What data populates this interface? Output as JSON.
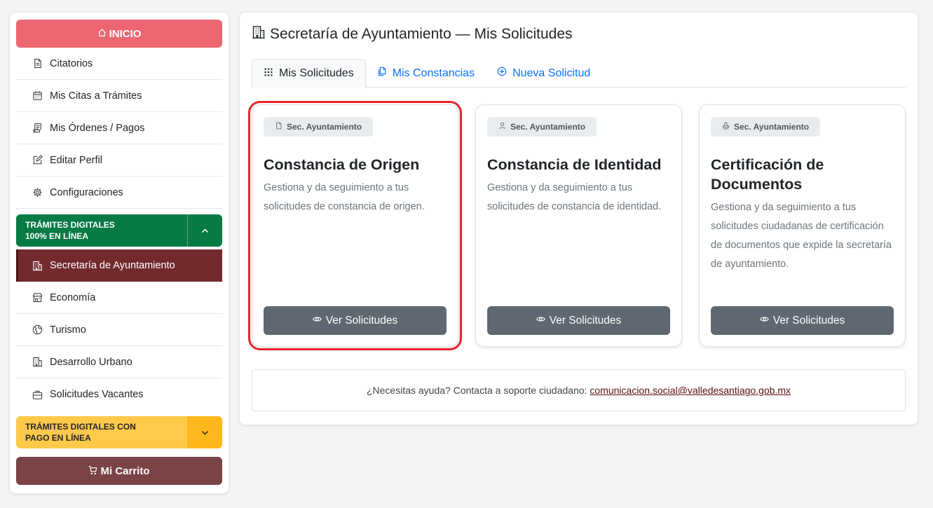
{
  "sidebar": {
    "inicio_label": "INICIO",
    "items": [
      {
        "label": "Citatorios",
        "icon": "file-icon"
      },
      {
        "label": "Mis Citas a Trámites",
        "icon": "calendar-icon"
      },
      {
        "label": "Mis Órdenes / Pagos",
        "icon": "receipt-icon"
      },
      {
        "label": "Editar Perfil",
        "icon": "edit-icon"
      },
      {
        "label": "Configuraciones",
        "icon": "gear-icon"
      }
    ],
    "group_online": {
      "line1": "TRÁMITES DIGITALES",
      "line2": "100% EN LÍNEA"
    },
    "online_items": [
      {
        "label": "Secretaría de Ayuntamiento",
        "icon": "building-icon",
        "active": true
      },
      {
        "label": "Economía",
        "icon": "shop-icon"
      },
      {
        "label": "Turismo",
        "icon": "globe-icon"
      },
      {
        "label": "Desarrollo Urbano",
        "icon": "building-icon"
      },
      {
        "label": "Solicitudes Vacantes",
        "icon": "briefcase-icon"
      }
    ],
    "group_paid": {
      "line1": "TRÁMITES DIGITALES CON",
      "line2": "PAGO EN LÍNEA"
    },
    "cart_label": "Mi Carrito"
  },
  "main": {
    "title": "Secretaría de Ayuntamiento — Mis Solicitudes",
    "tabs": [
      {
        "label": "Mis Solicitudes",
        "icon": "grid-icon",
        "active": true
      },
      {
        "label": "Mis Constancias",
        "icon": "copy-icon"
      },
      {
        "label": "Nueva Solicitud",
        "icon": "plus-circle-icon"
      }
    ],
    "cards": [
      {
        "badge": "Sec. Ayuntamiento",
        "badge_icon": "file-icon",
        "title": "Constancia de Origen",
        "description": "Gestiona y da seguimiento a tus solicitudes de constancia de origen.",
        "button": "Ver Solicitudes"
      },
      {
        "badge": "Sec. Ayuntamiento",
        "badge_icon": "person-icon",
        "title": "Constancia de Identidad",
        "description": "Gestiona y da seguimiento a tus solicitudes de constancia de identidad.",
        "button": "Ver Solicitudes"
      },
      {
        "badge": "Sec. Ayuntamiento",
        "badge_icon": "stamp-icon",
        "title": "Certificación de Documentos",
        "description": "Gestiona y da seguimiento a tus solicitudes ciudadanas de certificación de documentos que expide la secretaría de ayuntamiento.",
        "button": "Ver Solicitudes"
      }
    ],
    "help_text": "¿Necesitas ayuda? Contacta a soporte ciudadano:",
    "help_email": "comunicacion.social@valledesantiago.gob.mx"
  },
  "colors": {
    "inicio": "#ec6671",
    "green_group": "#087a44",
    "yellow_group": "#ffc94a",
    "active_item": "#722a2d",
    "cart": "#7a4346",
    "card_button": "#5f6871",
    "highlight": "#e8232a",
    "link": "#0d6efd"
  }
}
